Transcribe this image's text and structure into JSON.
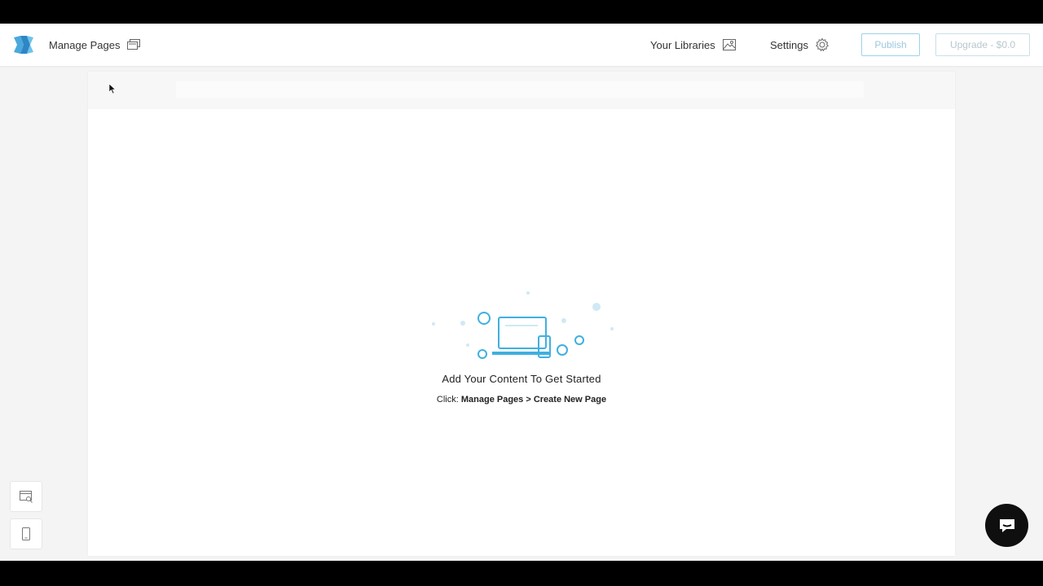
{
  "header": {
    "manage_pages_label": "Manage Pages",
    "libraries_label": "Your Libraries",
    "settings_label": "Settings",
    "publish_label": "Publish",
    "upgrade_label": "Upgrade - $0.0"
  },
  "empty_state": {
    "title": "Add Your Content To Get Started",
    "hint_prefix": "Click: ",
    "hint_path": "Manage Pages > Create New Page"
  },
  "colors": {
    "accent": "#3fb0e0",
    "background": "#f4f4f5",
    "chat_button": "#0f0f0f"
  },
  "icons": {
    "logo": "brand-logo-icon",
    "manage_pages": "pages-stack-icon",
    "libraries": "image-icon",
    "settings": "gear-icon",
    "preview": "desktop-preview-icon",
    "mobile": "mobile-icon",
    "chat": "chat-bubble-icon"
  }
}
